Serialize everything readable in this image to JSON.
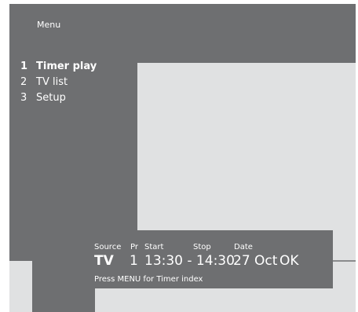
{
  "menu": {
    "title": "Menu",
    "items": [
      {
        "num": "1",
        "label": "Timer play"
      },
      {
        "num": "2",
        "label": "TV list"
      },
      {
        "num": "3",
        "label": "Setup"
      }
    ]
  },
  "timer": {
    "headers": {
      "source": "Source",
      "pr": "Pr",
      "start": "Start",
      "stop": "Stop",
      "date": "Date"
    },
    "values": {
      "source": "TV",
      "pr": "1",
      "time": "13:30 - 14:30",
      "date": "27 Oct",
      "ok": "OK"
    },
    "hint": "Press MENU for Timer index"
  },
  "colors": {
    "panel": "#6e6f71",
    "screen": "#e0e1e2",
    "text": "#ffffff"
  }
}
